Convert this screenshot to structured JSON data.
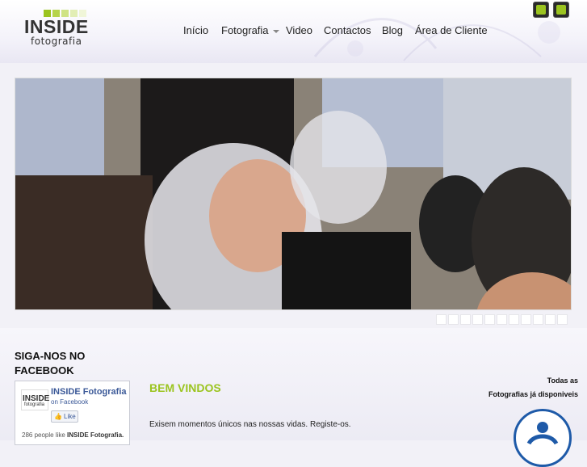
{
  "header": {
    "logo_text": "INSIDE",
    "logo_sub": "fotografia",
    "logo_squares": [
      "#9bc41f",
      "#b6d44a",
      "#cfe384",
      "#e2eeb4",
      "#f0f6d8",
      "#9bc41f"
    ],
    "nav": [
      {
        "label": "Início",
        "has_dropdown": false
      },
      {
        "label": "Fotografia",
        "has_dropdown": true
      },
      {
        "label": "Video",
        "has_dropdown": false
      },
      {
        "label": "Contactos",
        "has_dropdown": false
      },
      {
        "label": "Blog",
        "has_dropdown": false
      },
      {
        "label": "Área de Cliente",
        "has_dropdown": false
      }
    ],
    "social": [
      {
        "icon": "facebook-icon",
        "color": "#9bc41f"
      },
      {
        "icon": "rss-icon",
        "color": "#9bc41f"
      }
    ]
  },
  "slider": {
    "slide_count": 11,
    "active_slide": 1
  },
  "sidebar": {
    "title": "SIGA-NOS NO FACEBOOK",
    "fb_page_name": "INSIDE Fotografia",
    "fb_on": "on Facebook",
    "fb_like": "Like",
    "fb_logo_text": "INSIDE",
    "fb_logo_sub": "fotografia",
    "fb_count_prefix": "286 people like ",
    "fb_count_name": "INSIDE Fotografia."
  },
  "main": {
    "welcome_title": "BEM VINDOS",
    "intro_text": "Exisem momentos únicos nas nossas vidas. Registe-os."
  },
  "notice": {
    "line1": "Todas as",
    "line2": "Fotografias já disponiveis"
  },
  "colors": {
    "accent": "#9bc41f",
    "facebook": "#3b5998",
    "circle_logo": "#1e5aa8"
  }
}
